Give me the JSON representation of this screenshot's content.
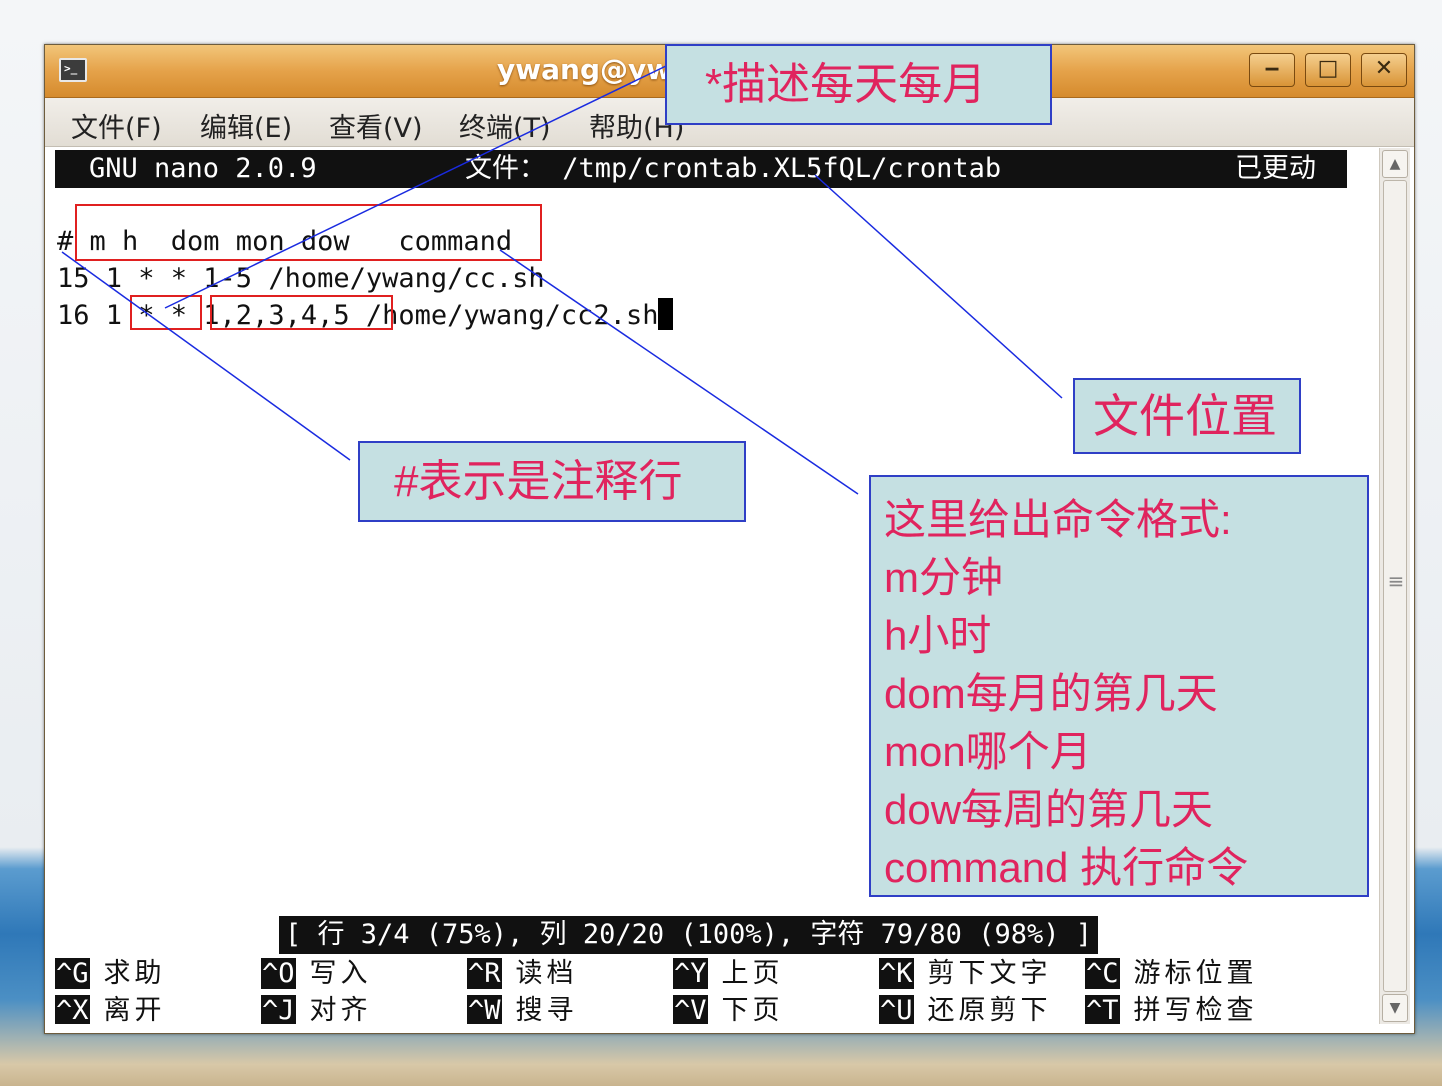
{
  "window": {
    "title": "ywang@yw",
    "controls": {
      "minimize": "‒",
      "maximize": "□",
      "close": "✕"
    }
  },
  "menu": [
    {
      "label": "文件(F)",
      "icon": ""
    },
    {
      "label": "编辑(E)"
    },
    {
      "label": "查看(V)"
    },
    {
      "label": "终端(T)"
    },
    {
      "label": "帮助(H)"
    }
  ],
  "nano": {
    "version": "GNU nano 2.0.9",
    "file": "文件： /tmp/crontab.XL5fQL/crontab",
    "modified": "已更动"
  },
  "editor_lines": [
    "# m h  dom mon dow   command",
    "15 1 * * 1-5 /home/ywang/cc.sh",
    "16 1 * * 1,2,3,4,5 /home/ywang/cc2.sh"
  ],
  "status": "[ 行 3/4 (75%), 列 20/20 (100%), 字符 79/80 (98%) ]",
  "shortcuts": [
    {
      "key": "^G",
      "label": "求助"
    },
    {
      "key": "^O",
      "label": "写入"
    },
    {
      "key": "^R",
      "label": "读档"
    },
    {
      "key": "^Y",
      "label": "上页"
    },
    {
      "key": "^K",
      "label": "剪下文字"
    },
    {
      "key": "^C",
      "label": "游标位置"
    },
    {
      "key": "^X",
      "label": "离开"
    },
    {
      "key": "^J",
      "label": "对齐"
    },
    {
      "key": "^W",
      "label": "搜寻"
    },
    {
      "key": "^V",
      "label": "下页"
    },
    {
      "key": "^U",
      "label": "还原剪下"
    },
    {
      "key": "^T",
      "label": "拼写检查"
    }
  ],
  "callouts": {
    "star": "*描述每天每月",
    "file_location": "文件位置",
    "hash": "#表示是注释行",
    "format": [
      "这里给出命令格式:",
      "m分钟",
      "h小时",
      "dom每月的第几天",
      "mon哪个月",
      "dow每周的第几天",
      "command 执行命令"
    ]
  },
  "colors": {
    "callout_bg": "#c5e0e2",
    "callout_text": "#e0245e",
    "callout_border": "#2f3fc6",
    "highlight_box": "#e02020"
  }
}
